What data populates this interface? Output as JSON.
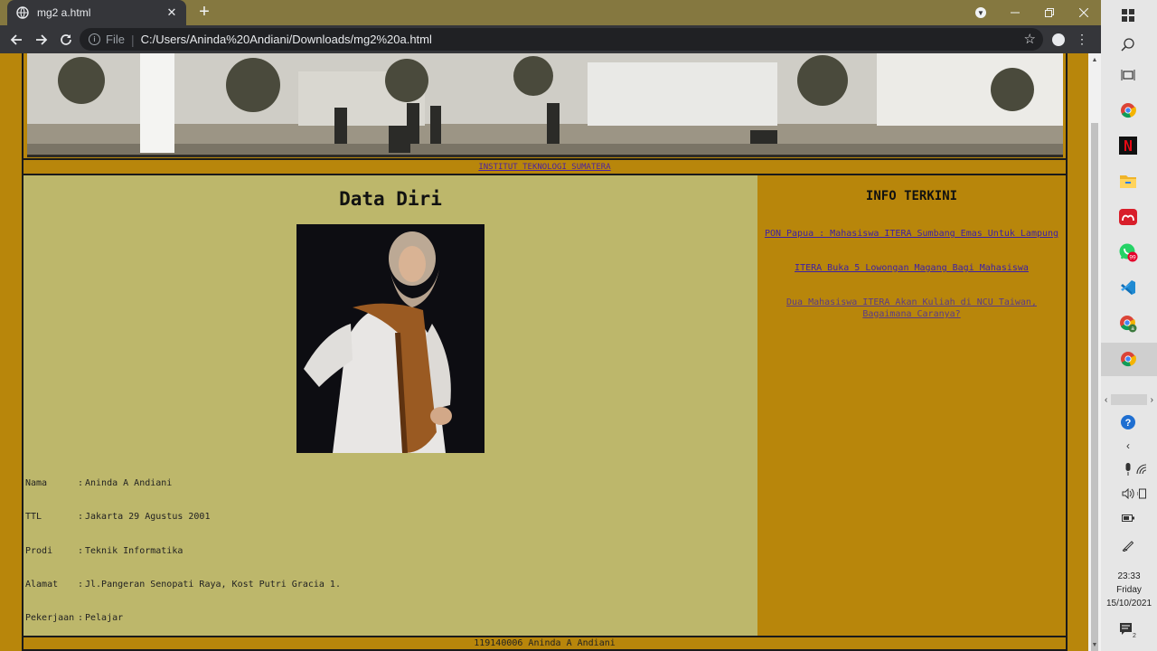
{
  "browser": {
    "tab_title": "mg2 a.html",
    "tab_close": "✕",
    "new_tab": "+",
    "scheme_label": "File",
    "url": "C:/Users/Aninda%20Andiani/Downloads/mg2%20a.html"
  },
  "page": {
    "institute_link": "INSTITUT TEKNOLOGI SUMATERA",
    "data_title": "Data Diri",
    "bio": [
      {
        "label": "Nama",
        "value": "Aninda A Andiani"
      },
      {
        "label": "TTL",
        "value": "Jakarta 29 Agustus 2001"
      },
      {
        "label": "Prodi",
        "value": "Teknik Informatika"
      },
      {
        "label": "Alamat",
        "value": "Jl.Pangeran Senopati Raya, Kost Putri Gracia 1."
      },
      {
        "label": "Pekerjaan",
        "value": "Pelajar"
      }
    ],
    "bio_separator": ":",
    "info_title": "INFO TERKINI",
    "news": [
      {
        "text": "PON Papua : Mahasiswa ITERA Sumbang Emas Untuk Lampung",
        "color": "#3c1fa6"
      },
      {
        "text": "ITERA Buka 5 Lowongan Magang Bagi Mahasiswa",
        "color": "#3c1fa6"
      },
      {
        "text": "Dua Mahasiswa ITERA Akan Kuliah di NCU Taiwan, Bagaimana Caranya?",
        "color": "#5a3b88"
      }
    ],
    "footer": "119140006 Aninda A Andiani"
  },
  "taskbar": {
    "icons": [
      "windows-start-icon",
      "search-icon",
      "task-view-icon",
      "chrome-icon",
      "netflix-icon",
      "file-explorer-icon",
      "mendeley-icon",
      "whatsapp-icon",
      "vscode-icon",
      "chrome-profile-icon",
      "chrome-active-icon"
    ],
    "whatsapp_badge": "99",
    "notification_count": "2",
    "time": "23:33",
    "day": "Friday",
    "date": "15/10/2021"
  },
  "colors": {
    "page_bg": "#b8860b",
    "main_panel": "#bdb76b",
    "link_visited": "#5a3b88",
    "link": "#3c1fa6",
    "browser_frame": "#857840"
  }
}
